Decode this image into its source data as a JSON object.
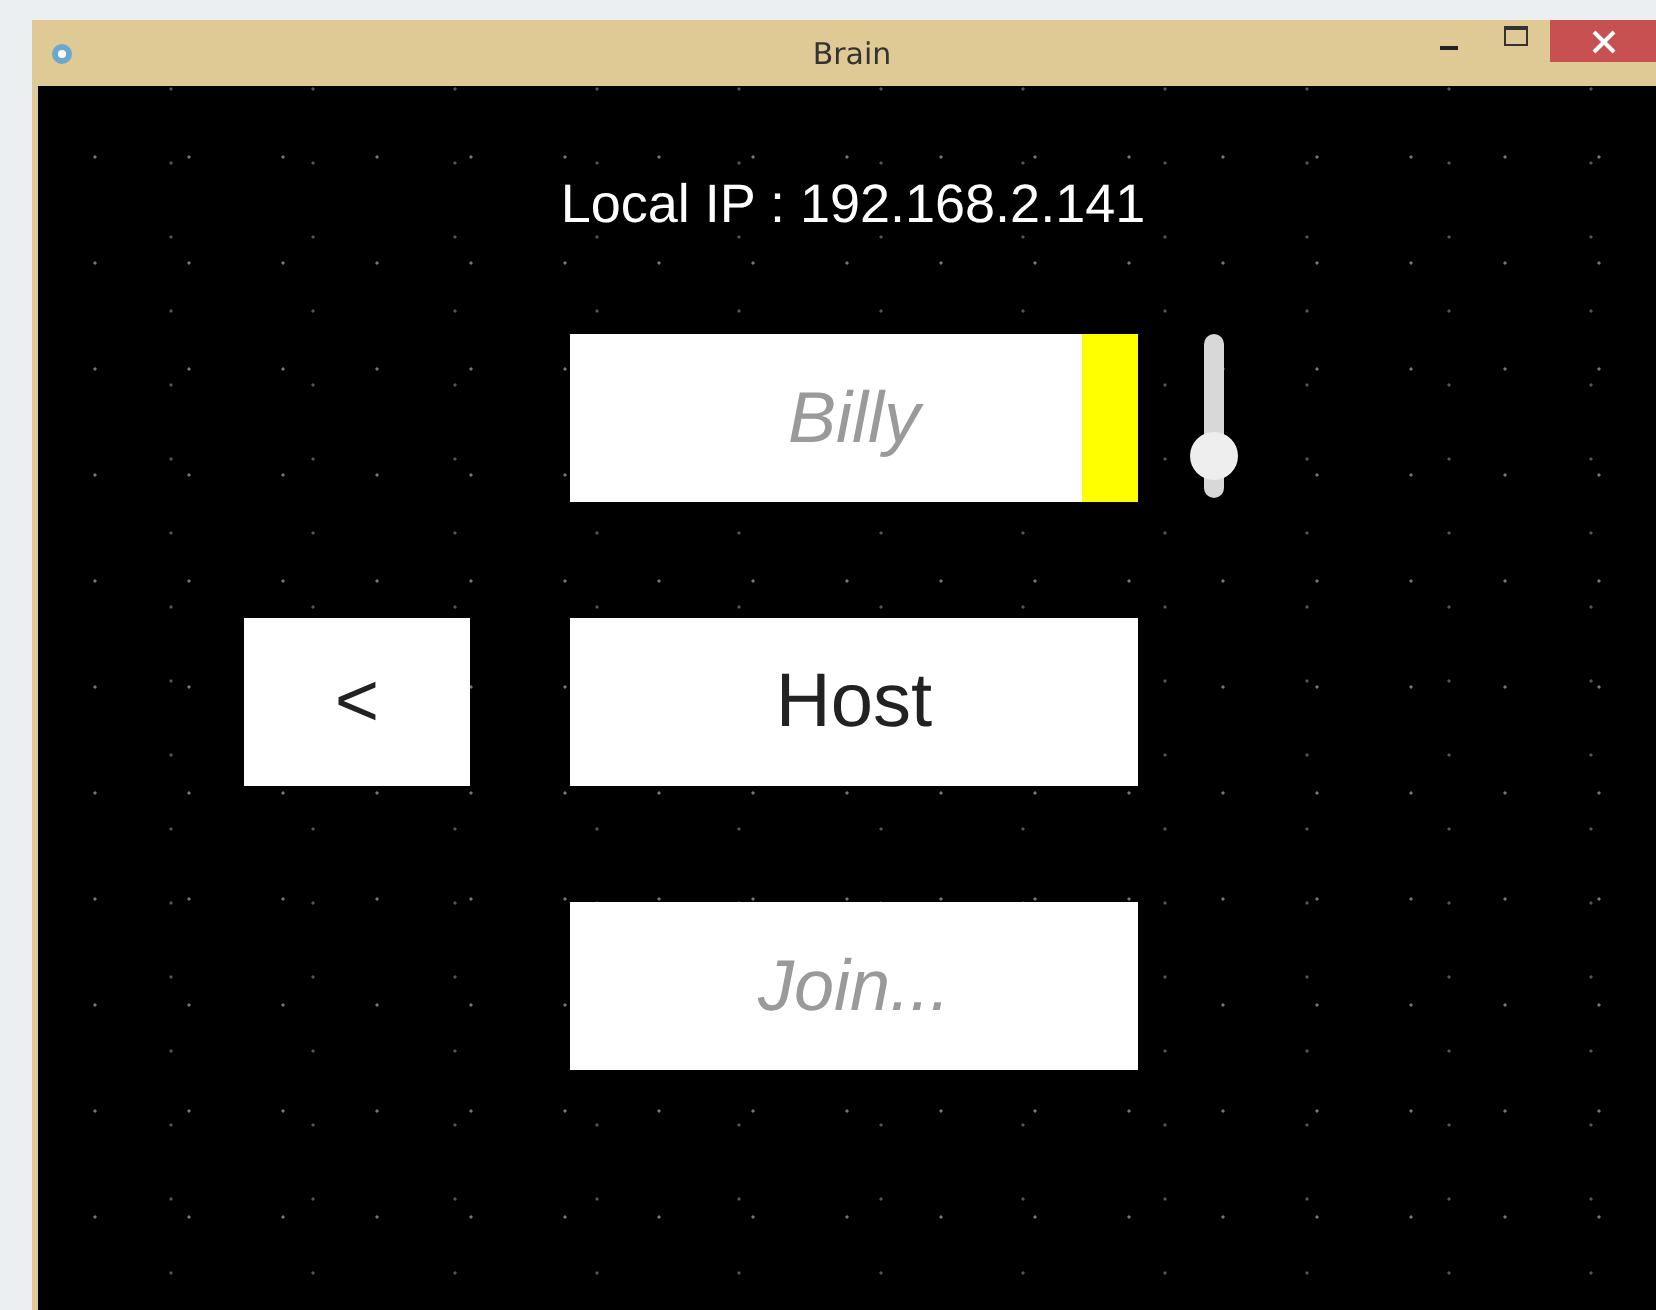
{
  "window": {
    "title": "Brain"
  },
  "local_ip": "Local IP : 192.168.2.141",
  "name_field": {
    "placeholder": "Billy",
    "color": "#ffff00"
  },
  "color_slider": {
    "level": 0.15
  },
  "buttons": [
    {
      "kind": "back",
      "label": "<"
    },
    {
      "kind": "host",
      "label": "Host"
    }
  ],
  "join_field": {
    "placeholder": "Join..."
  }
}
